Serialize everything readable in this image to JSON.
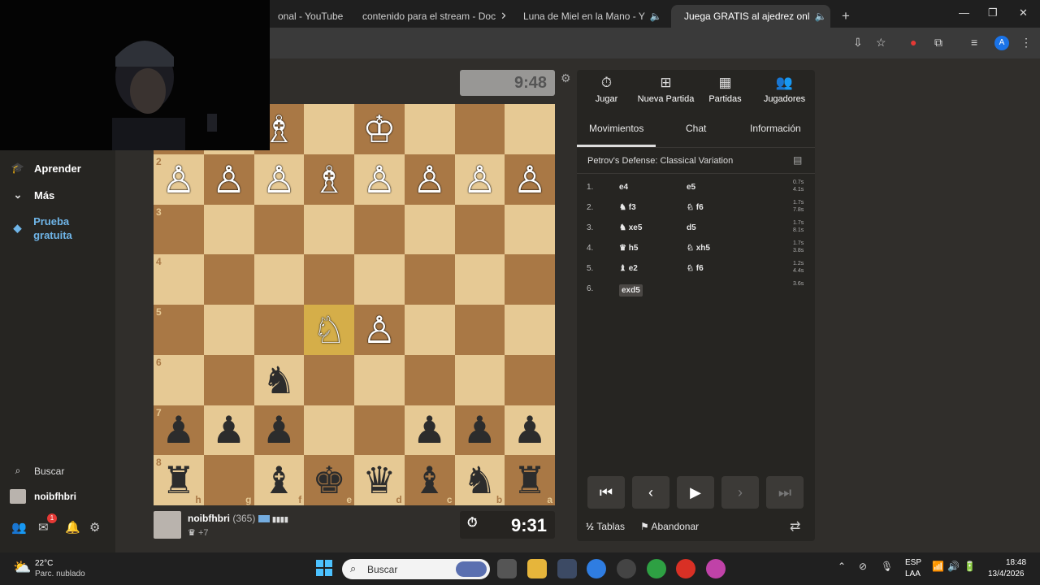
{
  "browser": {
    "tabs": [
      {
        "label": "onal - YouTube"
      },
      {
        "label": "contenido para el stream - Doc"
      },
      {
        "label": "Luna de Miel en la Mano - Y"
      },
      {
        "label": "Juega GRATIS al ajedrez onl"
      }
    ],
    "new_tab": "+",
    "profile_initial": "A"
  },
  "sidebar": {
    "aprender": "Aprender",
    "mas": "Más",
    "prueba": "Prueba gratuita",
    "buscar": "Buscar",
    "username": "noibfhbri",
    "mail_badge": "1"
  },
  "game": {
    "clock_top": "9:48",
    "clock_bottom": "9:31",
    "player_name": "noibfhbri",
    "player_rating": "(365)",
    "material": "+7",
    "board": [
      [
        "♜",
        "",
        "♝",
        "♚",
        "♛",
        "♝",
        "♞",
        "♜"
      ],
      [
        "♟",
        "♟",
        "♟",
        "",
        "",
        "♟",
        "♟",
        "♟"
      ],
      [
        "",
        "",
        "♞",
        "",
        "",
        "",
        "",
        ""
      ],
      [
        "",
        "",
        "",
        "♘",
        "♙",
        "",
        "",
        ""
      ],
      [
        "",
        "",
        "",
        "",
        "",
        "",
        "",
        ""
      ],
      [
        "",
        "",
        "",
        "",
        "",
        "",
        "",
        ""
      ],
      [
        "♙",
        "♙",
        "♙",
        "♗",
        "♙",
        "♙",
        "♙",
        "♙"
      ],
      [
        "♖",
        "♘",
        "♗",
        "",
        "♔",
        "",
        "",
        ""
      ]
    ],
    "ranks": [
      "8",
      "7",
      "6",
      "5",
      "4",
      "3",
      "2"
    ],
    "files": [
      "h",
      "g",
      "f",
      "e",
      "d",
      "c",
      "b",
      "a"
    ]
  },
  "panel": {
    "tabs": [
      "Jugar",
      "Nueva Partida",
      "Partidas",
      "Jugadores"
    ],
    "subtabs": [
      "Movimientos",
      "Chat",
      "Información"
    ],
    "opening": "Petrov's Defense: Classical Variation",
    "moves": [
      {
        "num": "1.",
        "white": "e4",
        "black": "e5",
        "t1": "0.7s",
        "t2": "4.1s"
      },
      {
        "num": "2.",
        "white": "♞ f3",
        "black": "♘ f6",
        "t1": "1.7s",
        "t2": "7.8s"
      },
      {
        "num": "3.",
        "white": "♞ xe5",
        "black": "d5",
        "t1": "1.7s",
        "t2": "8.1s"
      },
      {
        "num": "4.",
        "white": "♛ h5",
        "black": "♘ xh5",
        "t1": "1.7s",
        "t2": "3.8s"
      },
      {
        "num": "5.",
        "white": "♝ e2",
        "black": "♘ f6",
        "t1": "1.2s",
        "t2": "4.4s"
      },
      {
        "num": "6.",
        "white": "exd5",
        "black": "",
        "t1": "3.6s",
        "t2": ""
      }
    ],
    "draw": "Tablas",
    "draw_icon": "½",
    "resign": "Abandonar"
  },
  "taskbar": {
    "temp": "22°C",
    "weather": "Parc. nublado",
    "search": "Buscar",
    "lang1": "ESP",
    "lang2": "LAA",
    "time": "18:48",
    "date": "13/4/2026"
  }
}
